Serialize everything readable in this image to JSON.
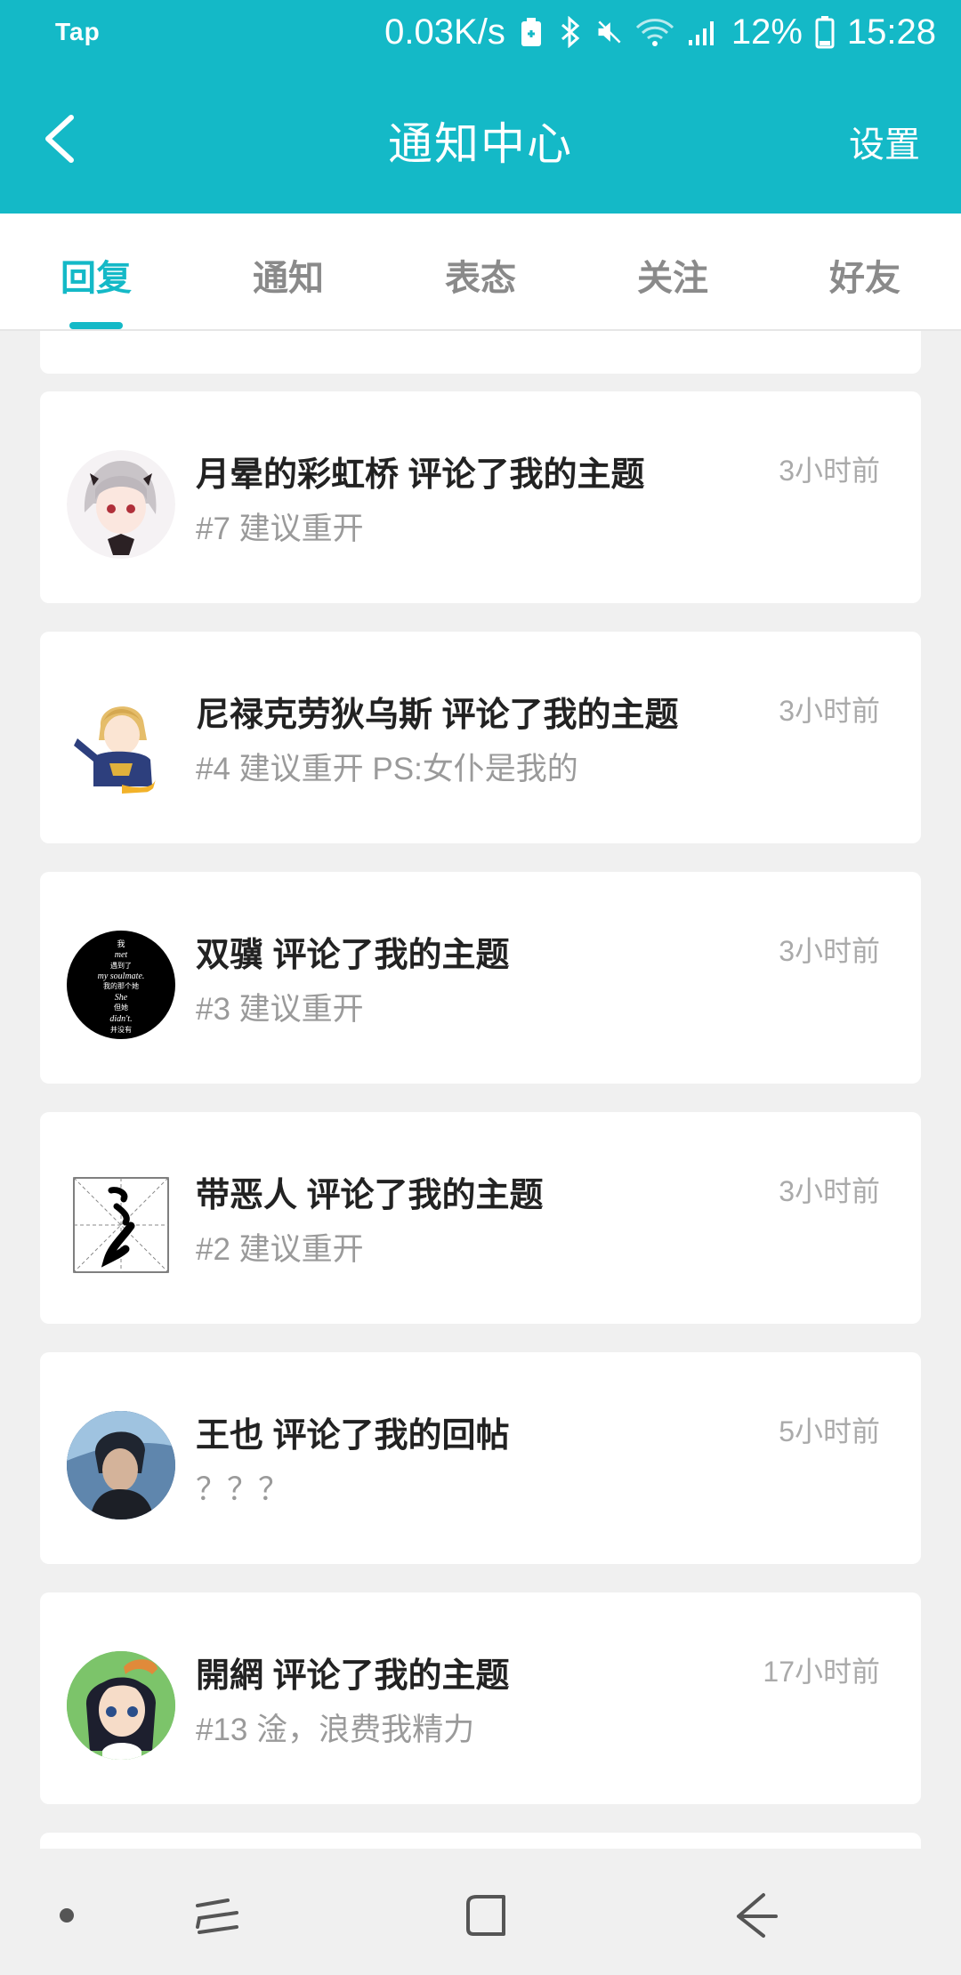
{
  "status": {
    "carrier_logo": "Tap",
    "speed": "0.03K/s",
    "battery_percent": "12%",
    "time": "15:28"
  },
  "appbar": {
    "title": "通知中心",
    "settings": "设置"
  },
  "tabs": [
    {
      "label": "回复",
      "active": true
    },
    {
      "label": "通知",
      "active": false
    },
    {
      "label": "表态",
      "active": false
    },
    {
      "label": "关注",
      "active": false
    },
    {
      "label": "好友",
      "active": false
    }
  ],
  "notifications": [
    {
      "title": "月晕的彩虹桥 评论了我的主题",
      "subtitle": "#7 建议重开",
      "time": "3小时前"
    },
    {
      "title": "尼禄克劳狄乌斯 评论了我的主题",
      "subtitle": "#4 建议重开 PS:女仆是我的",
      "time": "3小时前"
    },
    {
      "title": "双骥 评论了我的主题",
      "subtitle": "#3 建议重开",
      "time": "3小时前"
    },
    {
      "title": "带恶人 评论了我的主题",
      "subtitle": "#2 建议重开",
      "time": "3小时前"
    },
    {
      "title": "王也 评论了我的回帖",
      "subtitle": "？？？",
      "time": "5小时前"
    },
    {
      "title": "開網 评论了我的主题",
      "subtitle": "#13 淦，浪费我精力",
      "time": "17小时前"
    }
  ],
  "avatar3_text": [
    "我",
    "met",
    "遇到了",
    "my soulmate.",
    "我的那个她",
    "She",
    "但她",
    "didn't.",
    "并没有"
  ],
  "colors": {
    "accent": "#14b9c7",
    "title": "#222222",
    "subtitle": "#9a9a9a"
  }
}
